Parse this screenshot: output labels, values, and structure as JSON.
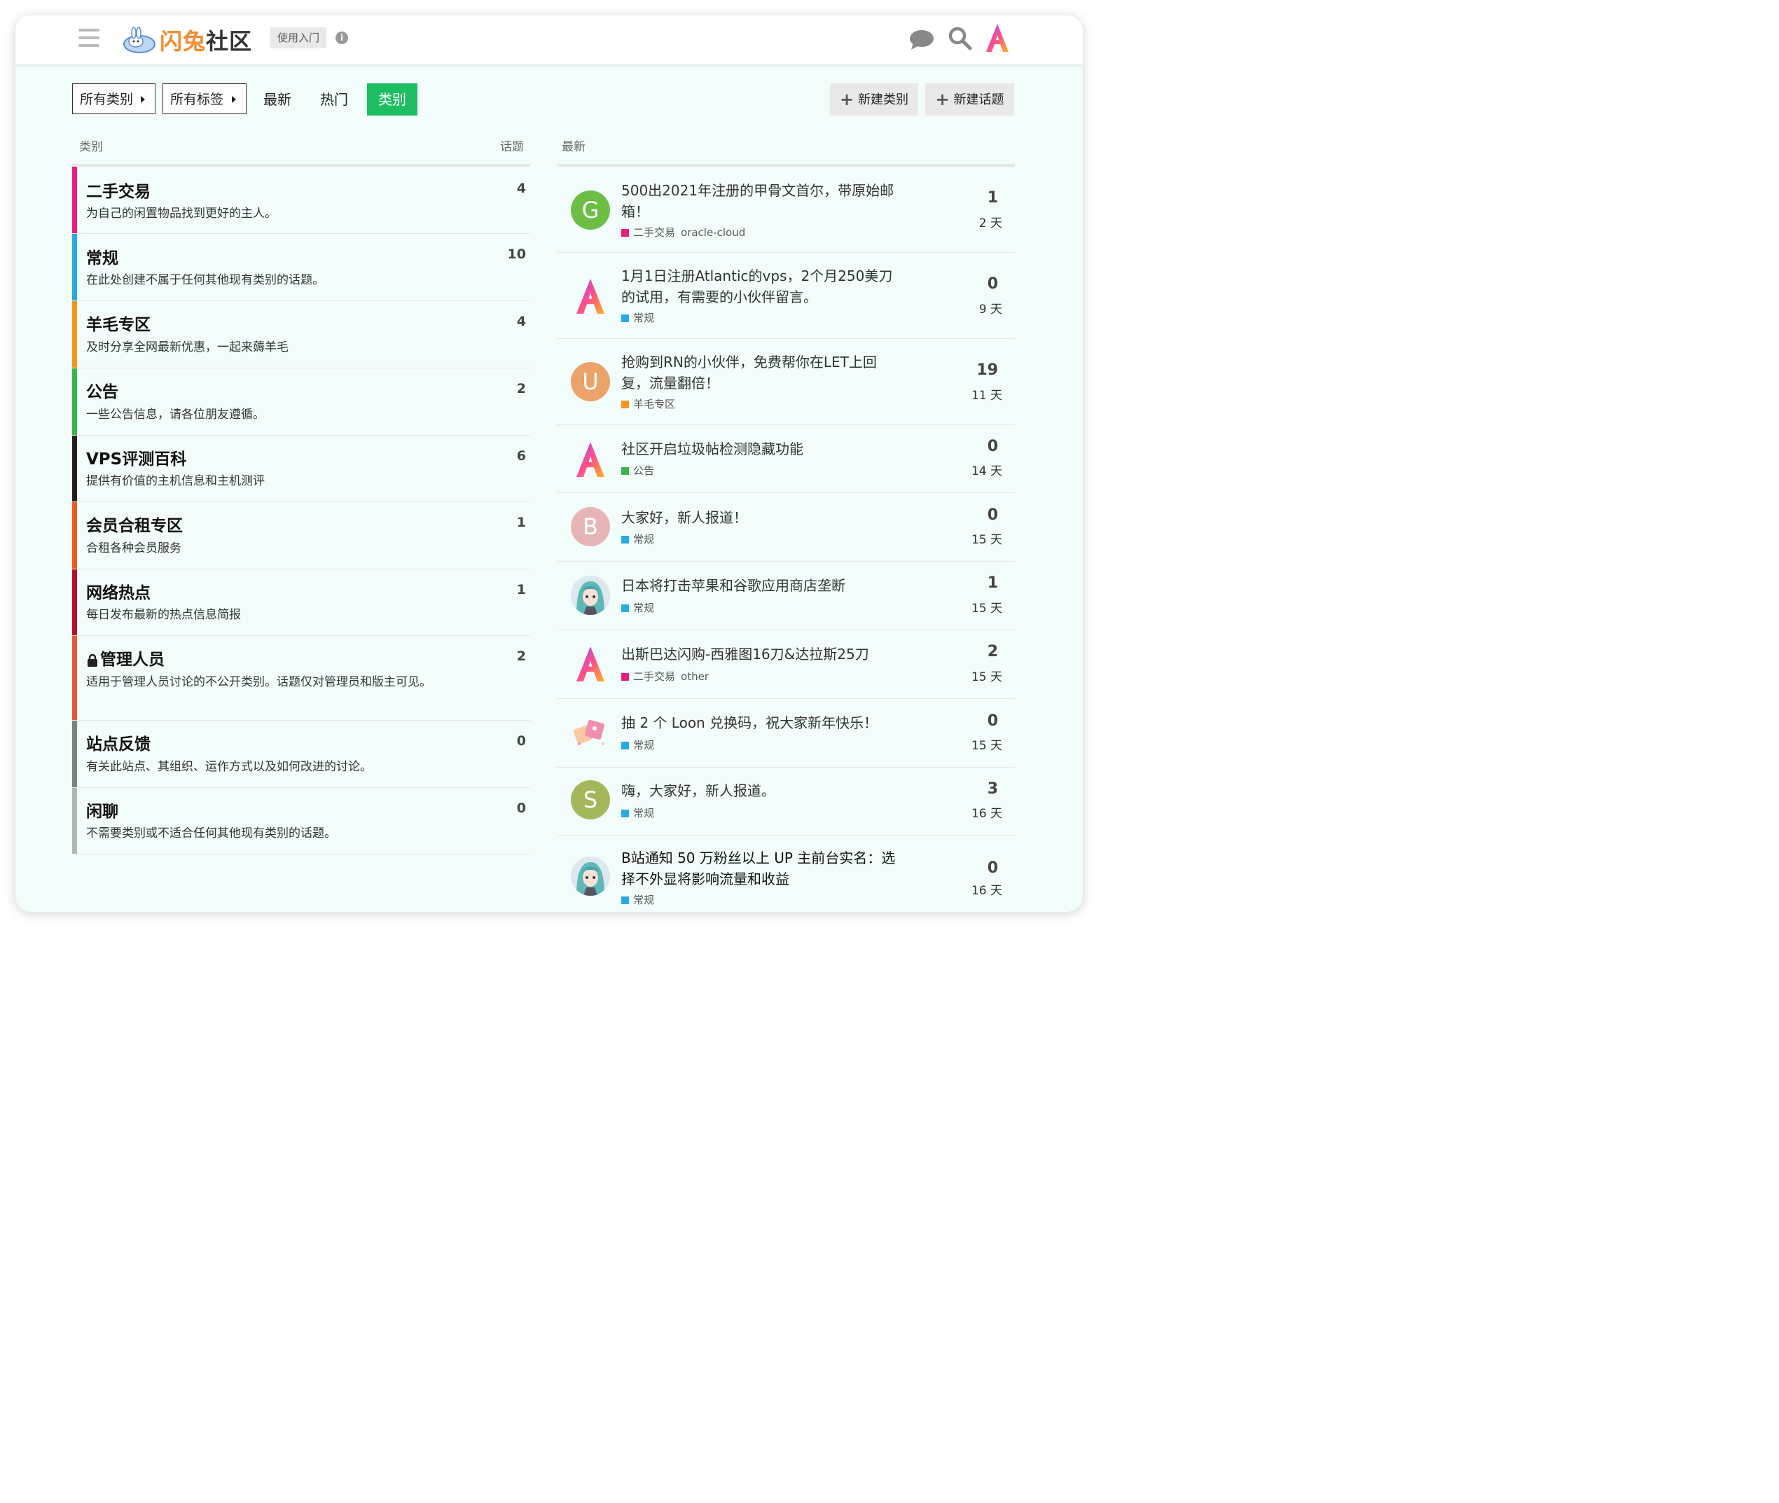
{
  "header": {
    "logo_text_orange": "闪兔",
    "logo_text_dark": "社区",
    "guide_button": "使用入门",
    "info_glyph": "i",
    "user_avatar_letter": "A"
  },
  "nav": {
    "all_categories": "所有类别",
    "all_tags": "所有标签",
    "latest": "最新",
    "top": "热门",
    "categories": "类别",
    "new_category": "新建类别",
    "new_topic": "新建话题",
    "plus": "+"
  },
  "columns": {
    "category": "类别",
    "topics": "话题",
    "latest": "最新"
  },
  "categories": [
    {
      "name": "二手交易",
      "desc": "为自己的闲置物品找到更好的主人。",
      "count": "4",
      "color": "#e91e79"
    },
    {
      "name": "常规",
      "desc": "在此处创建不属于任何其他现有类别的话题。",
      "count": "10",
      "color": "#25aae1"
    },
    {
      "name": "羊毛专区",
      "desc": "及时分享全网最新优惠，一起来薅羊毛",
      "count": "4",
      "color": "#f7941d"
    },
    {
      "name": "公告",
      "desc": "一些公告信息，请各位朋友遵循。",
      "count": "2",
      "color": "#3ab54a"
    },
    {
      "name": "VPS评测百科",
      "desc": "提供有价值的主机信息和主机测评",
      "count": "6",
      "color": "#231f20"
    },
    {
      "name": "会员合租专区",
      "desc": "合租各种会员服务",
      "count": "1",
      "color": "#f15a24"
    },
    {
      "name": "网络热点",
      "desc": "每日发布最新的热点信息简报",
      "count": "1",
      "color": "#b3122e"
    },
    {
      "name": "管理人员",
      "desc": "适用于管理人员讨论的不公开类别。话题仅对管理员和版主可见。",
      "count": "2",
      "color": "#e45735"
    },
    {
      "name": "站点反馈",
      "desc": "有关此站点、其组织、运作方式以及如何改进的讨论。",
      "count": "0",
      "color": "#808281"
    },
    {
      "name": "闲聊",
      "desc": "不需要类别或不适合任何其他现有类别的话题。",
      "count": "0",
      "color": "#b3b5b4"
    }
  ],
  "topics": [
    {
      "avatar": "G",
      "avatar_color": "#6cbf44",
      "title": "500出2021年注册的甲骨文首尔，带原始邮箱！",
      "category": "二手交易",
      "cat_color": "#e91e79",
      "tag": "oracle-cloud",
      "replies": "1",
      "age": "2 天"
    },
    {
      "avatar": "A",
      "avatar_color": "logo",
      "title": "1月1日注册Atlantic的vps，2个月250美刀的试用，有需要的小伙伴留言。",
      "category": "常规",
      "cat_color": "#25aae1",
      "tag": "",
      "replies": "0",
      "age": "9 天"
    },
    {
      "avatar": "U",
      "avatar_color": "#eba36a",
      "title": "抢购到RN的小伙伴，免费帮你在LET上回复，流量翻倍！",
      "category": "羊毛专区",
      "cat_color": "#f7941d",
      "tag": "",
      "replies": "19",
      "age": "11 天"
    },
    {
      "avatar": "A",
      "avatar_color": "logo",
      "title": "社区开启垃圾帖检测隐藏功能",
      "category": "公告",
      "cat_color": "#3ab54a",
      "tag": "",
      "replies": "0",
      "age": "14 天"
    },
    {
      "avatar": "B",
      "avatar_color": "#e7b5b5",
      "title": "大家好，新人报道！",
      "category": "常规",
      "cat_color": "#25aae1",
      "tag": "",
      "replies": "0",
      "age": "15 天"
    },
    {
      "avatar": "",
      "avatar_color": "anime",
      "title": "日本将打击苹果和谷歌应用商店垄断",
      "category": "常规",
      "cat_color": "#25aae1",
      "tag": "",
      "replies": "1",
      "age": "15 天"
    },
    {
      "avatar": "A",
      "avatar_color": "logo",
      "title": "出斯巴达闪购-西雅图16刀&达拉斯25刀",
      "category": "二手交易",
      "cat_color": "#e91e79",
      "tag": "other",
      "replies": "2",
      "age": "15 天"
    },
    {
      "avatar": "",
      "avatar_color": "gift",
      "title": "抽 2 个 Loon 兑换码，祝大家新年快乐！",
      "category": "常规",
      "cat_color": "#25aae1",
      "tag": "",
      "replies": "0",
      "age": "15 天"
    },
    {
      "avatar": "S",
      "avatar_color": "#a3b85b",
      "title": "嗨，大家好，新人报道。",
      "category": "常规",
      "cat_color": "#25aae1",
      "tag": "",
      "replies": "3",
      "age": "16 天"
    },
    {
      "avatar": "",
      "avatar_color": "anime",
      "title": "B站通知 50 万粉丝以上 UP 主前台实名：选择不外显将影响流量和收益",
      "category": "常规",
      "cat_color": "#25aae1",
      "tag": "",
      "replies": "0",
      "age": "16 天"
    }
  ]
}
